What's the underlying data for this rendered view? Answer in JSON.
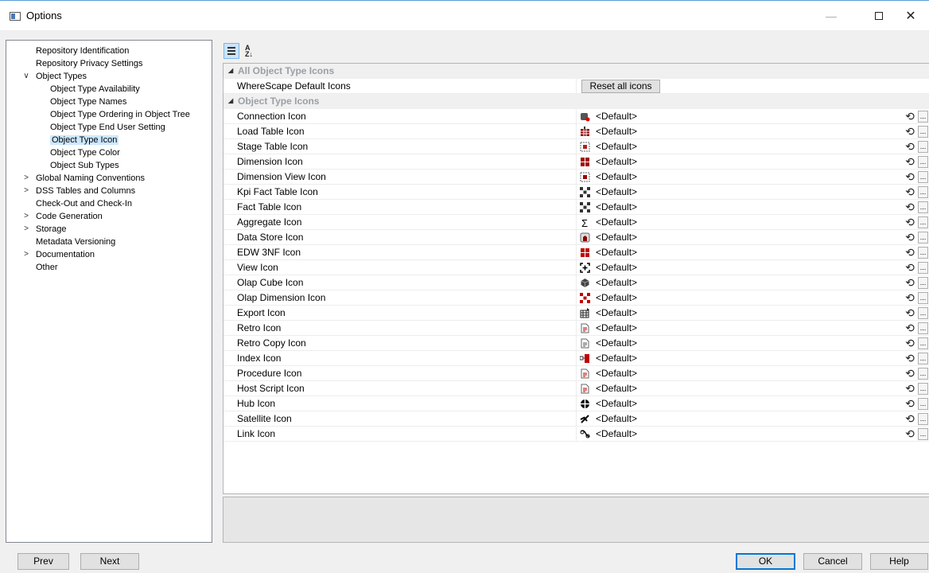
{
  "window": {
    "title": "Options"
  },
  "tree": {
    "items": [
      {
        "label": "Repository Identification",
        "level": 0,
        "chevron": ""
      },
      {
        "label": "Repository Privacy Settings",
        "level": 0,
        "chevron": ""
      },
      {
        "label": "Object Types",
        "level": 0,
        "chevron": "∨"
      },
      {
        "label": "Object Type Availability",
        "level": 1,
        "chevron": ""
      },
      {
        "label": "Object Type Names",
        "level": 1,
        "chevron": ""
      },
      {
        "label": "Object Type Ordering in Object Tree",
        "level": 1,
        "chevron": ""
      },
      {
        "label": "Object Type End User Setting",
        "level": 1,
        "chevron": ""
      },
      {
        "label": "Object Type Icon",
        "level": 1,
        "chevron": "",
        "selected": true
      },
      {
        "label": "Object Type Color",
        "level": 1,
        "chevron": ""
      },
      {
        "label": "Object Sub Types",
        "level": 1,
        "chevron": ""
      },
      {
        "label": "Global Naming Conventions",
        "level": 0,
        "chevron": ">"
      },
      {
        "label": "DSS Tables and Columns",
        "level": 0,
        "chevron": ">"
      },
      {
        "label": "Check-Out and Check-In",
        "level": 0,
        "chevron": ""
      },
      {
        "label": "Code Generation",
        "level": 0,
        "chevron": ">"
      },
      {
        "label": "Storage",
        "level": 0,
        "chevron": ">"
      },
      {
        "label": "Metadata Versioning",
        "level": 0,
        "chevron": ""
      },
      {
        "label": "Documentation",
        "level": 0,
        "chevron": ">"
      },
      {
        "label": "Other",
        "level": 0,
        "chevron": ""
      }
    ]
  },
  "toolbar": {
    "categorized_icon": "categorized-icon",
    "alphabetical_label": "A\nZ↓"
  },
  "grid": {
    "cat1": {
      "label": "All Object Type Icons"
    },
    "default_icons": {
      "label": "WhereScape Default Icons",
      "button": "Reset all icons"
    },
    "cat2": {
      "label": "Object Type Icons"
    },
    "default_value": "<Default>",
    "rows": [
      {
        "label": "Connection Icon",
        "icon": "connection-icon",
        "color": "#555555"
      },
      {
        "label": "Load Table Icon",
        "icon": "load-table-icon",
        "color": "#8b0000"
      },
      {
        "label": "Stage Table Icon",
        "icon": "stage-table-icon",
        "color": "#b22222"
      },
      {
        "label": "Dimension Icon",
        "icon": "dimension-icon",
        "color": "#a00000"
      },
      {
        "label": "Dimension View Icon",
        "icon": "dimension-view-icon",
        "color": "#a00000"
      },
      {
        "label": "Kpi Fact Table Icon",
        "icon": "kpi-fact-icon",
        "color": "#333333"
      },
      {
        "label": "Fact Table Icon",
        "icon": "fact-table-icon",
        "color": "#333333"
      },
      {
        "label": "Aggregate Icon",
        "icon": "sigma-icon",
        "color": "#000000"
      },
      {
        "label": "Data Store Icon",
        "icon": "data-store-icon",
        "color": "#8b0000"
      },
      {
        "label": "EDW 3NF Icon",
        "icon": "edw-3nf-icon",
        "color": "#c00000"
      },
      {
        "label": "View Icon",
        "icon": "view-icon",
        "color": "#000000"
      },
      {
        "label": "Olap Cube Icon",
        "icon": "olap-cube-icon",
        "color": "#444444"
      },
      {
        "label": "Olap Dimension Icon",
        "icon": "olap-dimension-icon",
        "color": "#c00000"
      },
      {
        "label": "Export Icon",
        "icon": "export-icon",
        "color": "#222222"
      },
      {
        "label": "Retro Icon",
        "icon": "retro-icon",
        "color": "#c00000"
      },
      {
        "label": "Retro Copy Icon",
        "icon": "retro-copy-icon",
        "color": "#555555"
      },
      {
        "label": "Index Icon",
        "icon": "index-icon",
        "color": "#c00000"
      },
      {
        "label": "Procedure Icon",
        "icon": "procedure-icon",
        "color": "#c00000"
      },
      {
        "label": "Host Script Icon",
        "icon": "host-script-icon",
        "color": "#c00000"
      },
      {
        "label": "Hub Icon",
        "icon": "hub-icon",
        "color": "#000000"
      },
      {
        "label": "Satellite Icon",
        "icon": "satellite-icon",
        "color": "#000000"
      },
      {
        "label": "Link Icon",
        "icon": "link-icon",
        "color": "#000000"
      }
    ]
  },
  "buttons": {
    "prev": "Prev",
    "next": "Next",
    "ok": "OK",
    "cancel": "Cancel",
    "help": "Help"
  },
  "colors": {
    "accent": "#0078d7",
    "selection": "#cce8ff"
  }
}
